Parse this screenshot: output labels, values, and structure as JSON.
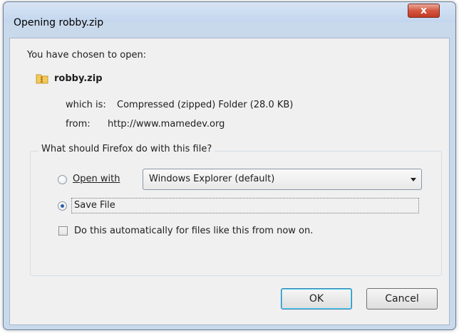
{
  "window": {
    "title": "Opening robby.zip",
    "close_label": "x"
  },
  "dialog": {
    "intro": "You have chosen to open:",
    "filename": "robby.zip",
    "which_is_label": "which is:",
    "which_is_value": "Compressed (zipped) Folder (28.0 KB)",
    "from_label": "from:",
    "from_value": "http://www.mamedev.org",
    "group_label": "What should Firefox do with this file?",
    "open_with_label": "Open with",
    "open_with_selected": "Windows Explorer (default)",
    "save_file_label": "Save File",
    "save_file_selected": true,
    "auto_label": "Do this automatically for files like this from now on.",
    "auto_checked": false
  },
  "buttons": {
    "ok": "OK",
    "cancel": "Cancel"
  },
  "colors": {
    "window_chrome": "#c9d9ec",
    "content_bg": "#f0f0f0",
    "close_button": "#c13a22",
    "default_button_border": "#3c7fb1"
  }
}
